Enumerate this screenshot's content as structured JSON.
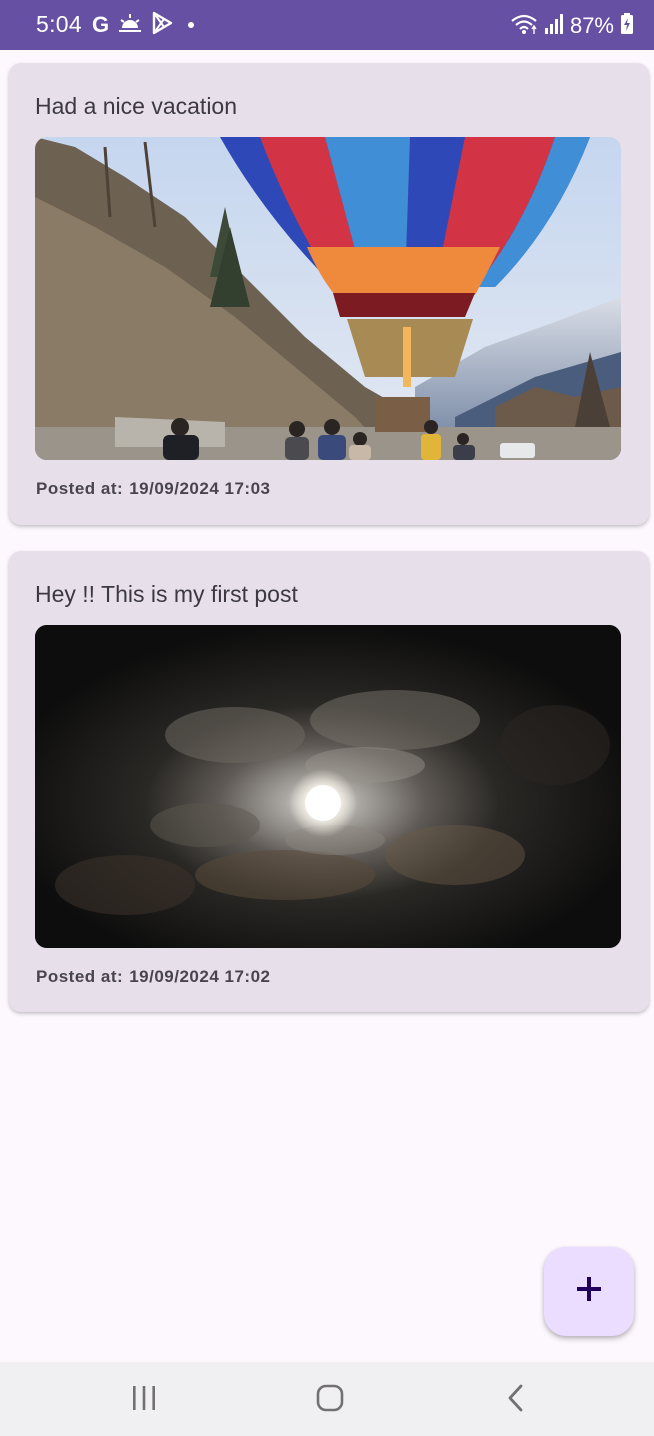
{
  "status_bar": {
    "time": "5:04",
    "google_glyph": "G",
    "battery": "87%",
    "icons": [
      "google-icon",
      "weather-icon",
      "play-store-icon",
      "notification-dot-icon",
      "wifi-icon",
      "signal-icon",
      "battery-charging-icon"
    ],
    "background_color": "#6650a4"
  },
  "posts": [
    {
      "title": "Had a nice vacation",
      "image": "hot-air-balloon-photo",
      "timestamp_label": "Posted at:",
      "timestamp_value": "19/09/2024 17:03"
    },
    {
      "title": "Hey !! This is my first post",
      "image": "full-moon-clouds-photo",
      "timestamp_label": "Posted at:",
      "timestamp_value": "19/09/2024 17:02"
    }
  ],
  "fab": {
    "icon": "plus-icon",
    "background_color": "#eaddff"
  },
  "nav_bar": {
    "items": [
      "recents-icon",
      "home-icon",
      "back-icon"
    ]
  },
  "colors": {
    "card_background": "#e7e0ea",
    "page_background": "#fdf8fe"
  }
}
